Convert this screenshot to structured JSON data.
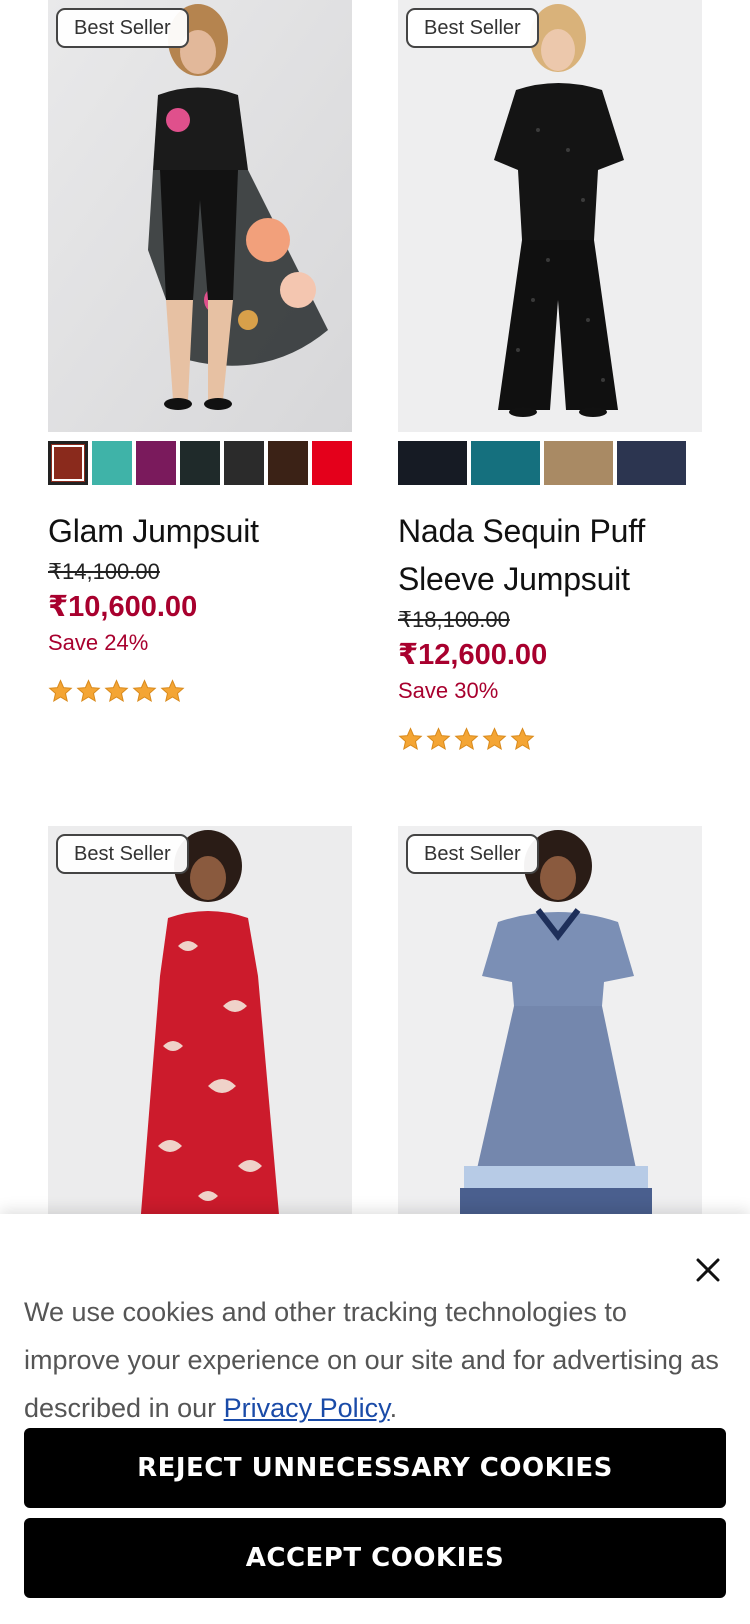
{
  "products": [
    {
      "badge": "Best Seller",
      "name": "Glam Jumpsuit",
      "original_price": "₹14,100.00",
      "sale_price": "₹10,600.00",
      "savings": "Save 24%",
      "rating": 5,
      "swatch_colors": [
        "#8a2a1c",
        "#3fb3a8",
        "#7a1a5c",
        "#1f2a2a",
        "#2b2b2b",
        "#3b2216",
        "#e4001b"
      ]
    },
    {
      "badge": "Best Seller",
      "name": "Nada Sequin Puff Sleeve Jumpsuit",
      "original_price": "₹18,100.00",
      "sale_price": "₹12,600.00",
      "savings": "Save 30%",
      "rating": 5,
      "swatch_colors": [
        "#161b24",
        "#15707e",
        "#a98a64",
        "#2c3550"
      ]
    },
    {
      "badge": "Best Seller"
    },
    {
      "badge": "Best Seller"
    }
  ],
  "cookie_banner": {
    "message": "We use cookies and other tracking technologies to improve your experience on our site and for advertising as described in our ",
    "link_text": "Privacy Policy",
    "message_end": ".",
    "reject_label": "REJECT UNNECESSARY COOKIES",
    "accept_label": "ACCEPT COOKIES",
    "close_icon": "close-icon"
  },
  "colors": {
    "sale_red": "#a8002e",
    "star_gold": "#f4a534",
    "button_black": "#000000",
    "link_blue": "#1a4ba8"
  }
}
